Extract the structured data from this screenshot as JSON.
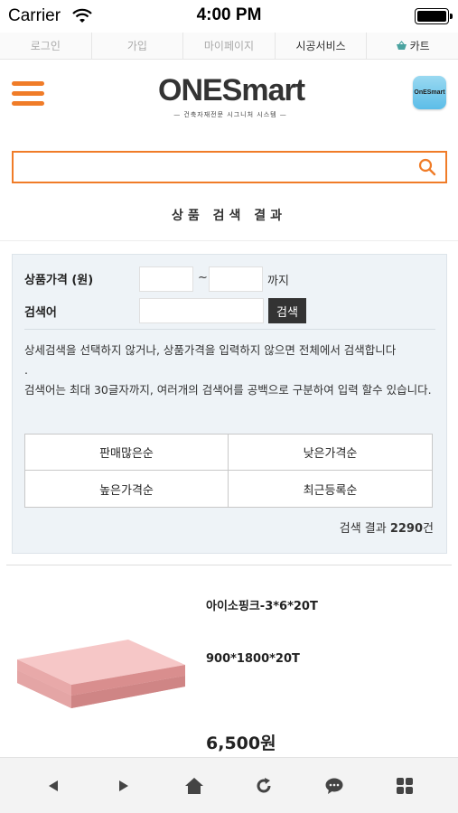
{
  "status_bar": {
    "carrier": "Carrier",
    "time": "4:00 PM"
  },
  "top_links": [
    {
      "label": "로그인"
    },
    {
      "label": "가입"
    },
    {
      "label": "마이페이지"
    },
    {
      "label": "시공서비스"
    },
    {
      "label": "카트"
    }
  ],
  "header": {
    "logo_text": "ONESmart",
    "logo_subtitle": "— 건축자재전문 시그니처 시스템 —",
    "app_icon_text": "OnESmart"
  },
  "search": {
    "value": "",
    "placeholder": ""
  },
  "section_title": "상품 검색 결과",
  "filter": {
    "price_label": "상품가격 (원)",
    "tilde": "~",
    "until": "까지",
    "keyword_label": "검색어",
    "search_button": "검색",
    "note_line1": "상세검색을 선택하지 않거나, 상품가격을 입력하지 않으면 전체에서 검색합니다",
    "note_line2": ".",
    "note_line3": "검색어는 최대 30글자까지, 여러개의 검색어를 공백으로 구분하여 입력 할수 있습니다.",
    "sort_options": [
      "판매많은순",
      "낮은가격순",
      "높은가격순",
      "최근등록순"
    ],
    "result_prefix": "검색 결과 ",
    "result_count": "2290",
    "result_suffix": "건"
  },
  "product": {
    "name": "아이소핑크-3*6*20T",
    "size": "900*1800*20T",
    "price": "6,500원"
  },
  "colors": {
    "accent": "#f07c28",
    "panel": "#eef3f7"
  }
}
